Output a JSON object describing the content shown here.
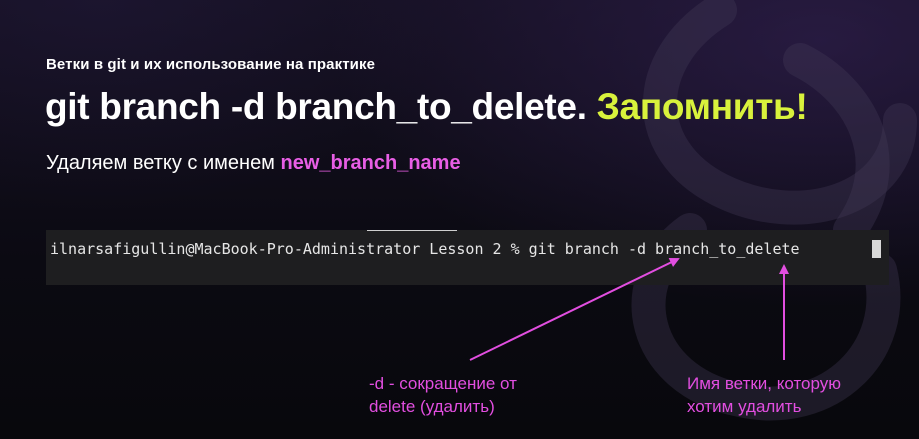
{
  "slide": {
    "section_title": "Ветки в git и их использование на практике",
    "heading_command": "git branch -d branch_to_delete.",
    "heading_accent": "Запомнить!",
    "description_prefix": "Удаляем ветку с именем",
    "description_branch": "new_branch_name"
  },
  "terminal": {
    "command_line": "ilnarsafigullin@MacBook-Pro-Administrator Lesson 2 % git branch -d branch_to_delete"
  },
  "annotations": {
    "flag_note_line1": "-d - сокращение от",
    "flag_note_line2": "delete (удалить)",
    "name_note_line1": "Имя ветки, которую",
    "name_note_line2": "хотим удалить"
  },
  "colors": {
    "accent_yellow": "#d9f23c",
    "accent_pink": "#e85ee5",
    "background": "#0a0a0f"
  }
}
